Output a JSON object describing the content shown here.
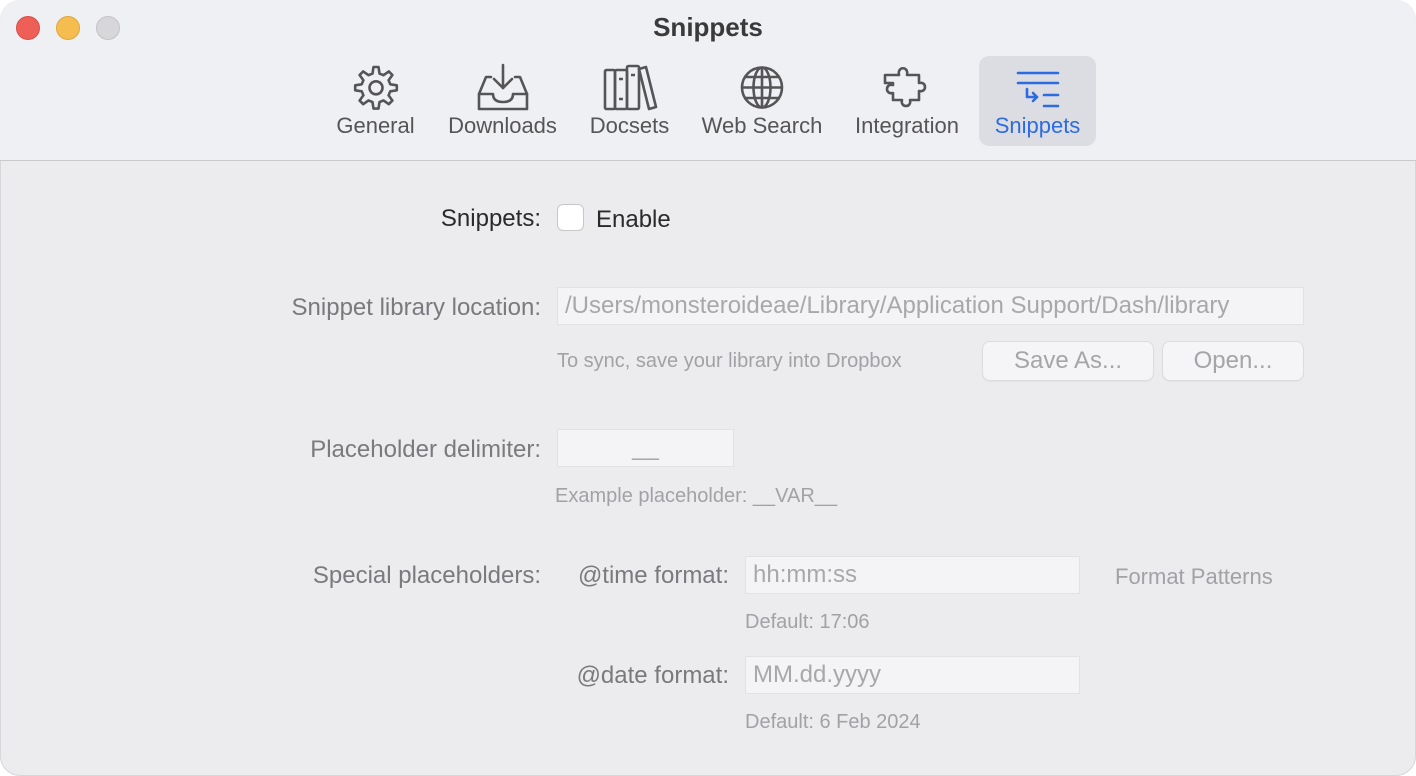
{
  "window": {
    "title": "Snippets"
  },
  "tabs": [
    {
      "label": "General",
      "icon": "gear-icon"
    },
    {
      "label": "Downloads",
      "icon": "download-tray-icon"
    },
    {
      "label": "Docsets",
      "icon": "books-icon"
    },
    {
      "label": "Web Search",
      "icon": "globe-icon"
    },
    {
      "label": "Integration",
      "icon": "puzzle-icon"
    },
    {
      "label": "Snippets",
      "icon": "snippets-icon",
      "active": true
    }
  ],
  "colors": {
    "accent": "#2d6be0",
    "close": "#ee5f57",
    "minimize": "#f5bd4f",
    "zoom": "#d7d7da"
  },
  "snippets": {
    "label": "Snippets:",
    "enable_label": "Enable",
    "enabled": false
  },
  "library": {
    "label": "Snippet library location:",
    "path": "/Users/monsteroideae/Library/Application Support/Dash/library",
    "hint": "To sync, save your library into Dropbox",
    "save_as_label": "Save As...",
    "open_label": "Open..."
  },
  "placeholder": {
    "label": "Placeholder delimiter:",
    "value": "__",
    "example": "Example placeholder: __VAR__"
  },
  "special": {
    "label": "Special placeholders:",
    "time_label": "@time format:",
    "time_placeholder": "hh:mm:ss",
    "time_default": "Default: 17:06",
    "format_patterns_label": "Format Patterns",
    "date_label": "@date format:",
    "date_placeholder": "MM.dd.yyyy",
    "date_default": "Default: 6 Feb 2024"
  }
}
